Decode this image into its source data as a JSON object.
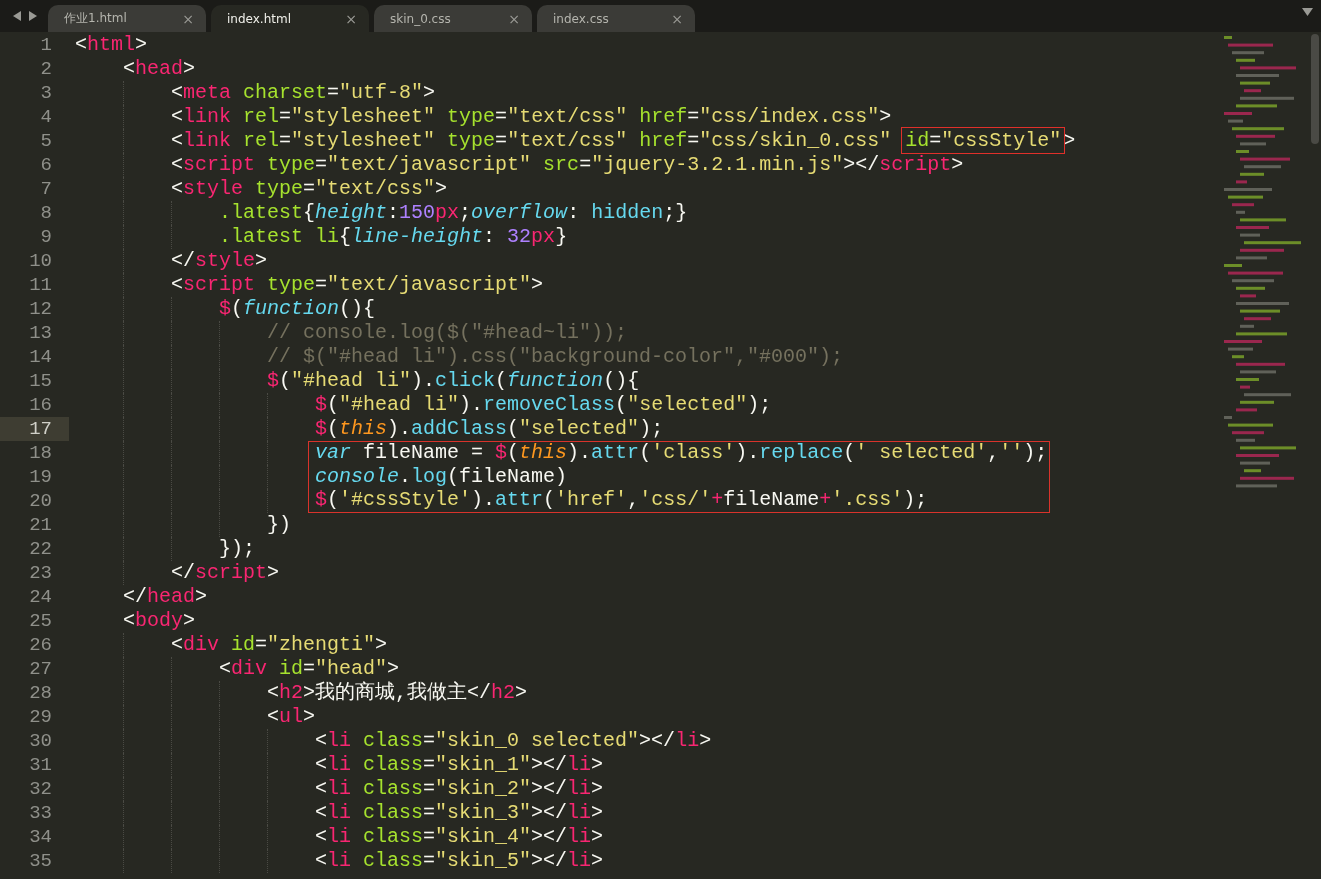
{
  "tabs": [
    {
      "label": "作业1.html",
      "close": "×",
      "selected": false
    },
    {
      "label": "index.html",
      "close": "×",
      "selected": true
    },
    {
      "label": "skin_0.css",
      "close": "×",
      "selected": false
    },
    {
      "label": "index.css",
      "close": "×",
      "selected": false
    }
  ],
  "lines": [
    {
      "number": "1",
      "current": false,
      "boxed": false,
      "tokens": [
        {
          "kind": "plain",
          "text": "<"
        },
        {
          "kind": "tag",
          "text": "html"
        },
        {
          "kind": "plain",
          "text": ">"
        }
      ],
      "children": [
        {
          "number": "2",
          "current": false,
          "boxed": false,
          "tokens": [
            {
              "kind": "plain",
              "text": "<"
            },
            {
              "kind": "tag",
              "text": "head"
            },
            {
              "kind": "plain",
              "text": ">"
            }
          ],
          "children": [
            {
              "number": "3",
              "current": false,
              "boxed": false,
              "tokens": [
                {
                  "kind": "plain",
                  "text": "<"
                },
                {
                  "kind": "tag",
                  "text": "meta"
                },
                {
                  "kind": "attr",
                  "text": " charset"
                },
                {
                  "kind": "plain",
                  "text": "="
                },
                {
                  "kind": "str",
                  "text": "\"utf-8\""
                },
                {
                  "kind": "plain",
                  "text": ">"
                }
              ]
            },
            {
              "number": "4",
              "current": false,
              "boxed": false,
              "tokens": [
                {
                  "kind": "plain",
                  "text": "<"
                },
                {
                  "kind": "tag",
                  "text": "link"
                },
                {
                  "kind": "attr",
                  "text": " rel"
                },
                {
                  "kind": "plain",
                  "text": "="
                },
                {
                  "kind": "str",
                  "text": "\"stylesheet\""
                },
                {
                  "kind": "attr",
                  "text": " type"
                },
                {
                  "kind": "plain",
                  "text": "="
                },
                {
                  "kind": "str",
                  "text": "\"text/css\""
                },
                {
                  "kind": "attr",
                  "text": " href"
                },
                {
                  "kind": "plain",
                  "text": "="
                },
                {
                  "kind": "str",
                  "text": "\"css/index.css\""
                },
                {
                  "kind": "plain",
                  "text": ">"
                }
              ]
            },
            {
              "number": "5",
              "current": false,
              "boxed": false,
              "tokens": [
                {
                  "kind": "plain",
                  "text": "<"
                },
                {
                  "kind": "tag",
                  "text": "link"
                },
                {
                  "kind": "attr",
                  "text": " rel"
                },
                {
                  "kind": "plain",
                  "text": "="
                },
                {
                  "kind": "str",
                  "text": "\"stylesheet\""
                },
                {
                  "kind": "attr",
                  "text": " type"
                },
                {
                  "kind": "plain",
                  "text": "="
                },
                {
                  "kind": "str",
                  "text": "\"text/css\""
                },
                {
                  "kind": "attr",
                  "text": " href"
                },
                {
                  "kind": "plain",
                  "text": "="
                },
                {
                  "kind": "str",
                  "text": "\"css/skin_0.css\" "
                },
                {
                  "kind": "box",
                  "tokens": [
                    {
                      "kind": "attr",
                      "text": "id"
                    },
                    {
                      "kind": "plain",
                      "text": "="
                    },
                    {
                      "kind": "str",
                      "text": "\"cssStyle\""
                    }
                  ]
                },
                {
                  "kind": "plain",
                  "text": ">"
                }
              ]
            },
            {
              "number": "6",
              "current": false,
              "boxed": false,
              "tokens": [
                {
                  "kind": "plain",
                  "text": "<"
                },
                {
                  "kind": "tag",
                  "text": "script"
                },
                {
                  "kind": "attr",
                  "text": " type"
                },
                {
                  "kind": "plain",
                  "text": "="
                },
                {
                  "kind": "str",
                  "text": "\"text/javascript\""
                },
                {
                  "kind": "attr",
                  "text": " src"
                },
                {
                  "kind": "plain",
                  "text": "="
                },
                {
                  "kind": "str",
                  "text": "\"jquery-3.2.1.min.js\""
                },
                {
                  "kind": "plain",
                  "text": "></"
                },
                {
                  "kind": "tag",
                  "text": "script"
                },
                {
                  "kind": "plain",
                  "text": ">"
                }
              ]
            },
            {
              "number": "7",
              "current": false,
              "boxed": false,
              "tokens": [
                {
                  "kind": "plain",
                  "text": "<"
                },
                {
                  "kind": "tag",
                  "text": "style"
                },
                {
                  "kind": "attr",
                  "text": " type"
                },
                {
                  "kind": "plain",
                  "text": "="
                },
                {
                  "kind": "str",
                  "text": "\"text/css\""
                },
                {
                  "kind": "plain",
                  "text": ">"
                }
              ],
              "children": [
                {
                  "number": "8",
                  "current": false,
                  "boxed": false,
                  "tokens": [
                    {
                      "kind": "attr",
                      "text": ".latest"
                    },
                    {
                      "kind": "plain",
                      "text": "{"
                    },
                    {
                      "kind": "kw",
                      "text": "height"
                    },
                    {
                      "kind": "plain",
                      "text": ":"
                    },
                    {
                      "kind": "num",
                      "text": "150"
                    },
                    {
                      "kind": "op",
                      "text": "px"
                    },
                    {
                      "kind": "plain",
                      "text": ";"
                    },
                    {
                      "kind": "kw",
                      "text": "overflow"
                    },
                    {
                      "kind": "plain",
                      "text": ": "
                    },
                    {
                      "kind": "fn",
                      "text": "hidden"
                    },
                    {
                      "kind": "plain",
                      "text": ";}"
                    }
                  ]
                },
                {
                  "number": "9",
                  "current": false,
                  "boxed": false,
                  "tokens": [
                    {
                      "kind": "attr",
                      "text": ".latest li"
                    },
                    {
                      "kind": "plain",
                      "text": "{"
                    },
                    {
                      "kind": "kw",
                      "text": "line-height"
                    },
                    {
                      "kind": "plain",
                      "text": ": "
                    },
                    {
                      "kind": "num",
                      "text": "32"
                    },
                    {
                      "kind": "op",
                      "text": "px"
                    },
                    {
                      "kind": "plain",
                      "text": "}"
                    }
                  ]
                }
              ]
            },
            {
              "number": "10",
              "current": false,
              "boxed": false,
              "tokens": [
                {
                  "kind": "plain",
                  "text": "</"
                },
                {
                  "kind": "tag",
                  "text": "style"
                },
                {
                  "kind": "plain",
                  "text": ">"
                }
              ]
            },
            {
              "number": "11",
              "current": false,
              "boxed": false,
              "tokens": [
                {
                  "kind": "plain",
                  "text": "<"
                },
                {
                  "kind": "tag",
                  "text": "script"
                },
                {
                  "kind": "attr",
                  "text": " type"
                },
                {
                  "kind": "plain",
                  "text": "="
                },
                {
                  "kind": "str",
                  "text": "\"text/javascript\""
                },
                {
                  "kind": "plain",
                  "text": ">"
                }
              ],
              "children": [
                {
                  "number": "12",
                  "current": false,
                  "boxed": false,
                  "tokens": [
                    {
                      "kind": "op",
                      "text": "$"
                    },
                    {
                      "kind": "plain",
                      "text": "("
                    },
                    {
                      "kind": "kw",
                      "text": "function"
                    },
                    {
                      "kind": "plain",
                      "text": "(){"
                    }
                  ],
                  "children": [
                    {
                      "number": "13",
                      "current": false,
                      "boxed": false,
                      "tokens": [
                        {
                          "kind": "comment",
                          "text": "// console.log($(\"#head~li\"));"
                        }
                      ]
                    },
                    {
                      "number": "14",
                      "current": false,
                      "boxed": false,
                      "tokens": [
                        {
                          "kind": "comment",
                          "text": "// $(\"#head li\").css(\"background-color\",\"#000\");"
                        }
                      ]
                    },
                    {
                      "number": "15",
                      "current": false,
                      "boxed": false,
                      "tokens": [
                        {
                          "kind": "op",
                          "text": "$"
                        },
                        {
                          "kind": "plain",
                          "text": "("
                        },
                        {
                          "kind": "str",
                          "text": "\"#head li\""
                        },
                        {
                          "kind": "plain",
                          "text": ")."
                        },
                        {
                          "kind": "fn",
                          "text": "click"
                        },
                        {
                          "kind": "plain",
                          "text": "("
                        },
                        {
                          "kind": "kw",
                          "text": "function"
                        },
                        {
                          "kind": "plain",
                          "text": "(){"
                        }
                      ],
                      "children": [
                        {
                          "number": "16",
                          "current": false,
                          "boxed": false,
                          "tokens": [
                            {
                              "kind": "op",
                              "text": "$"
                            },
                            {
                              "kind": "plain",
                              "text": "("
                            },
                            {
                              "kind": "str",
                              "text": "\"#head li\""
                            },
                            {
                              "kind": "plain",
                              "text": ")."
                            },
                            {
                              "kind": "fn",
                              "text": "removeClass"
                            },
                            {
                              "kind": "plain",
                              "text": "("
                            },
                            {
                              "kind": "str",
                              "text": "\"selected\""
                            },
                            {
                              "kind": "plain",
                              "text": ");"
                            }
                          ]
                        },
                        {
                          "number": "17",
                          "current": true,
                          "boxed": false,
                          "tokens": [
                            {
                              "kind": "op",
                              "text": "$"
                            },
                            {
                              "kind": "plain",
                              "text": "("
                            },
                            {
                              "kind": "this",
                              "text": "this"
                            },
                            {
                              "kind": "plain",
                              "text": ")."
                            },
                            {
                              "kind": "fn",
                              "text": "addClass"
                            },
                            {
                              "kind": "plain",
                              "text": "("
                            },
                            {
                              "kind": "str",
                              "text": "\"selected\""
                            },
                            {
                              "kind": "plain",
                              "text": ");"
                            }
                          ]
                        },
                        {
                          "number": "18",
                          "current": false,
                          "boxed": true,
                          "tokens": [
                            {
                              "kind": "kw",
                              "text": "var"
                            },
                            {
                              "kind": "plain",
                              "text": " fileName = "
                            },
                            {
                              "kind": "op",
                              "text": "$"
                            },
                            {
                              "kind": "plain",
                              "text": "("
                            },
                            {
                              "kind": "this",
                              "text": "this"
                            },
                            {
                              "kind": "plain",
                              "text": ")."
                            },
                            {
                              "kind": "fn",
                              "text": "attr"
                            },
                            {
                              "kind": "plain",
                              "text": "("
                            },
                            {
                              "kind": "str",
                              "text": "'class'"
                            },
                            {
                              "kind": "plain",
                              "text": ")."
                            },
                            {
                              "kind": "fn",
                              "text": "replace"
                            },
                            {
                              "kind": "plain",
                              "text": "("
                            },
                            {
                              "kind": "str",
                              "text": "' selected'"
                            },
                            {
                              "kind": "plain",
                              "text": ","
                            },
                            {
                              "kind": "str",
                              "text": "''"
                            },
                            {
                              "kind": "plain",
                              "text": ");"
                            }
                          ]
                        },
                        {
                          "number": "19",
                          "current": false,
                          "boxed": true,
                          "tokens": [
                            {
                              "kind": "kw",
                              "text": "console"
                            },
                            {
                              "kind": "plain",
                              "text": "."
                            },
                            {
                              "kind": "fn",
                              "text": "log"
                            },
                            {
                              "kind": "plain",
                              "text": "(fileName)"
                            }
                          ]
                        },
                        {
                          "number": "20",
                          "current": false,
                          "boxed": true,
                          "tokens": [
                            {
                              "kind": "op",
                              "text": "$"
                            },
                            {
                              "kind": "plain",
                              "text": "("
                            },
                            {
                              "kind": "str",
                              "text": "'#cssStyle'"
                            },
                            {
                              "kind": "plain",
                              "text": ")."
                            },
                            {
                              "kind": "fn",
                              "text": "attr"
                            },
                            {
                              "kind": "plain",
                              "text": "("
                            },
                            {
                              "kind": "str",
                              "text": "'href'"
                            },
                            {
                              "kind": "plain",
                              "text": ","
                            },
                            {
                              "kind": "str",
                              "text": "'css/'"
                            },
                            {
                              "kind": "op",
                              "text": "+"
                            },
                            {
                              "kind": "plain",
                              "text": "fileName"
                            },
                            {
                              "kind": "op",
                              "text": "+"
                            },
                            {
                              "kind": "str",
                              "text": "'.css'"
                            },
                            {
                              "kind": "plain",
                              "text": ");"
                            }
                          ]
                        }
                      ]
                    },
                    {
                      "number": "21",
                      "current": false,
                      "boxed": false,
                      "tokens": [
                        {
                          "kind": "plain",
                          "text": "})"
                        }
                      ]
                    }
                  ]
                },
                {
                  "number": "22",
                  "current": false,
                  "boxed": false,
                  "tokens": [
                    {
                      "kind": "plain",
                      "text": "});"
                    }
                  ]
                }
              ]
            },
            {
              "number": "23",
              "current": false,
              "boxed": false,
              "tokens": [
                {
                  "kind": "plain",
                  "text": "</"
                },
                {
                  "kind": "tag",
                  "text": "script"
                },
                {
                  "kind": "plain",
                  "text": ">"
                }
              ]
            }
          ]
        },
        {
          "number": "24",
          "current": false,
          "boxed": false,
          "tokens": [
            {
              "kind": "plain",
              "text": "</"
            },
            {
              "kind": "tag",
              "text": "head"
            },
            {
              "kind": "plain",
              "text": ">"
            }
          ]
        },
        {
          "number": "25",
          "current": false,
          "boxed": false,
          "tokens": [
            {
              "kind": "plain",
              "text": "<"
            },
            {
              "kind": "tag",
              "text": "body"
            },
            {
              "kind": "plain",
              "text": ">"
            }
          ],
          "children": [
            {
              "number": "26",
              "current": false,
              "boxed": false,
              "tokens": [
                {
                  "kind": "plain",
                  "text": "<"
                },
                {
                  "kind": "tag",
                  "text": "div"
                },
                {
                  "kind": "attr",
                  "text": " id"
                },
                {
                  "kind": "plain",
                  "text": "="
                },
                {
                  "kind": "str",
                  "text": "\"zhengti\""
                },
                {
                  "kind": "plain",
                  "text": ">"
                }
              ],
              "children": [
                {
                  "number": "27",
                  "current": false,
                  "boxed": false,
                  "tokens": [
                    {
                      "kind": "plain",
                      "text": "<"
                    },
                    {
                      "kind": "tag",
                      "text": "div"
                    },
                    {
                      "kind": "attr",
                      "text": " id"
                    },
                    {
                      "kind": "plain",
                      "text": "="
                    },
                    {
                      "kind": "str",
                      "text": "\"head\""
                    },
                    {
                      "kind": "plain",
                      "text": ">"
                    }
                  ],
                  "children": [
                    {
                      "number": "28",
                      "current": false,
                      "boxed": false,
                      "tokens": [
                        {
                          "kind": "plain",
                          "text": "<"
                        },
                        {
                          "kind": "tag",
                          "text": "h2"
                        },
                        {
                          "kind": "plain",
                          "text": ">我的商城,我做主</"
                        },
                        {
                          "kind": "tag",
                          "text": "h2"
                        },
                        {
                          "kind": "plain",
                          "text": ">"
                        }
                      ]
                    },
                    {
                      "number": "29",
                      "current": false,
                      "boxed": false,
                      "tokens": [
                        {
                          "kind": "plain",
                          "text": "<"
                        },
                        {
                          "kind": "tag",
                          "text": "ul"
                        },
                        {
                          "kind": "plain",
                          "text": ">"
                        }
                      ],
                      "children": [
                        {
                          "number": "30",
                          "current": false,
                          "boxed": false,
                          "tokens": [
                            {
                              "kind": "plain",
                              "text": "<"
                            },
                            {
                              "kind": "tag",
                              "text": "li"
                            },
                            {
                              "kind": "attr",
                              "text": " class"
                            },
                            {
                              "kind": "plain",
                              "text": "="
                            },
                            {
                              "kind": "str",
                              "text": "\"skin_0 selected\""
                            },
                            {
                              "kind": "plain",
                              "text": "></"
                            },
                            {
                              "kind": "tag",
                              "text": "li"
                            },
                            {
                              "kind": "plain",
                              "text": ">"
                            }
                          ]
                        },
                        {
                          "number": "31",
                          "current": false,
                          "boxed": false,
                          "tokens": [
                            {
                              "kind": "plain",
                              "text": "<"
                            },
                            {
                              "kind": "tag",
                              "text": "li"
                            },
                            {
                              "kind": "attr",
                              "text": " class"
                            },
                            {
                              "kind": "plain",
                              "text": "="
                            },
                            {
                              "kind": "str",
                              "text": "\"skin_1\""
                            },
                            {
                              "kind": "plain",
                              "text": "></"
                            },
                            {
                              "kind": "tag",
                              "text": "li"
                            },
                            {
                              "kind": "plain",
                              "text": ">"
                            }
                          ]
                        },
                        {
                          "number": "32",
                          "current": false,
                          "boxed": false,
                          "tokens": [
                            {
                              "kind": "plain",
                              "text": "<"
                            },
                            {
                              "kind": "tag",
                              "text": "li"
                            },
                            {
                              "kind": "attr",
                              "text": " class"
                            },
                            {
                              "kind": "plain",
                              "text": "="
                            },
                            {
                              "kind": "str",
                              "text": "\"skin_2\""
                            },
                            {
                              "kind": "plain",
                              "text": "></"
                            },
                            {
                              "kind": "tag",
                              "text": "li"
                            },
                            {
                              "kind": "plain",
                              "text": ">"
                            }
                          ]
                        },
                        {
                          "number": "33",
                          "current": false,
                          "boxed": false,
                          "tokens": [
                            {
                              "kind": "plain",
                              "text": "<"
                            },
                            {
                              "kind": "tag",
                              "text": "li"
                            },
                            {
                              "kind": "attr",
                              "text": " class"
                            },
                            {
                              "kind": "plain",
                              "text": "="
                            },
                            {
                              "kind": "str",
                              "text": "\"skin_3\""
                            },
                            {
                              "kind": "plain",
                              "text": "></"
                            },
                            {
                              "kind": "tag",
                              "text": "li"
                            },
                            {
                              "kind": "plain",
                              "text": ">"
                            }
                          ]
                        },
                        {
                          "number": "34",
                          "current": false,
                          "boxed": false,
                          "tokens": [
                            {
                              "kind": "plain",
                              "text": "<"
                            },
                            {
                              "kind": "tag",
                              "text": "li"
                            },
                            {
                              "kind": "attr",
                              "text": " class"
                            },
                            {
                              "kind": "plain",
                              "text": "="
                            },
                            {
                              "kind": "str",
                              "text": "\"skin_4\""
                            },
                            {
                              "kind": "plain",
                              "text": "></"
                            },
                            {
                              "kind": "tag",
                              "text": "li"
                            },
                            {
                              "kind": "plain",
                              "text": ">"
                            }
                          ]
                        },
                        {
                          "number": "35",
                          "current": false,
                          "boxed": false,
                          "tokens": [
                            {
                              "kind": "plain",
                              "text": "<"
                            },
                            {
                              "kind": "tag",
                              "text": "li"
                            },
                            {
                              "kind": "attr",
                              "text": " class"
                            },
                            {
                              "kind": "plain",
                              "text": "="
                            },
                            {
                              "kind": "str",
                              "text": "\"skin_5\""
                            },
                            {
                              "kind": "plain",
                              "text": "></"
                            },
                            {
                              "kind": "tag",
                              "text": "li"
                            },
                            {
                              "kind": "plain",
                              "text": ">"
                            }
                          ]
                        }
                      ]
                    }
                  ]
                }
              ]
            }
          ]
        }
      ]
    }
  ]
}
